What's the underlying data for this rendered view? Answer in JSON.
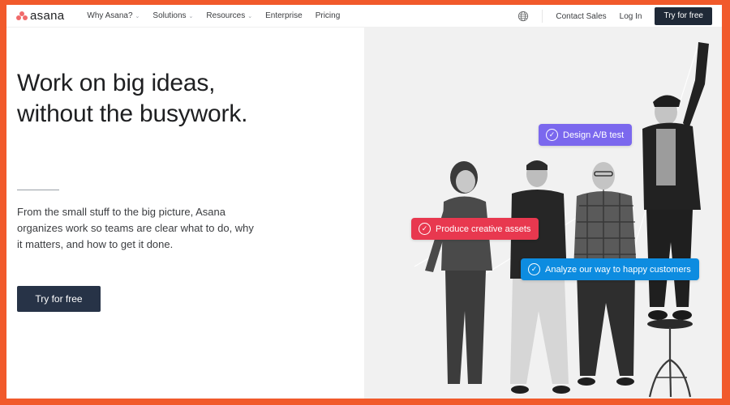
{
  "nav": {
    "logo_text": "asana",
    "links": [
      {
        "label": "Why Asana?",
        "has_dropdown": true
      },
      {
        "label": "Solutions",
        "has_dropdown": true
      },
      {
        "label": "Resources",
        "has_dropdown": true
      },
      {
        "label": "Enterprise",
        "has_dropdown": false
      },
      {
        "label": "Pricing",
        "has_dropdown": false
      }
    ],
    "globe_icon": "globe-icon",
    "contact_sales": "Contact Sales",
    "log_in": "Log In",
    "try_free": "Try for free",
    "dropdown_glyph": "⌄"
  },
  "hero": {
    "headline_line1": "Work on big ideas,",
    "headline_line2": "without the busywork.",
    "subtext": "From the small stuff to the big picture, Asana organizes work so teams are clear what to do, why it matters, and how to get it done.",
    "cta": "Try for free"
  },
  "image": {
    "description": "Black-and-white photo of four smiling people connected by string, one standing on a stool",
    "tags": [
      {
        "label": "Design A/B test",
        "color": "#7b68ee",
        "icon": "check-circle-icon"
      },
      {
        "label": "Produce creative assets",
        "color": "#e8384f",
        "icon": "check-circle-icon"
      },
      {
        "label": "Analyze our way to happy customers",
        "color": "#0d8ce0",
        "icon": "check-circle-icon"
      }
    ],
    "check_glyph": "✓"
  },
  "colors": {
    "frame": "#f15a2b",
    "brand_coral": "#f06a6a",
    "button_dark": "#273347"
  }
}
